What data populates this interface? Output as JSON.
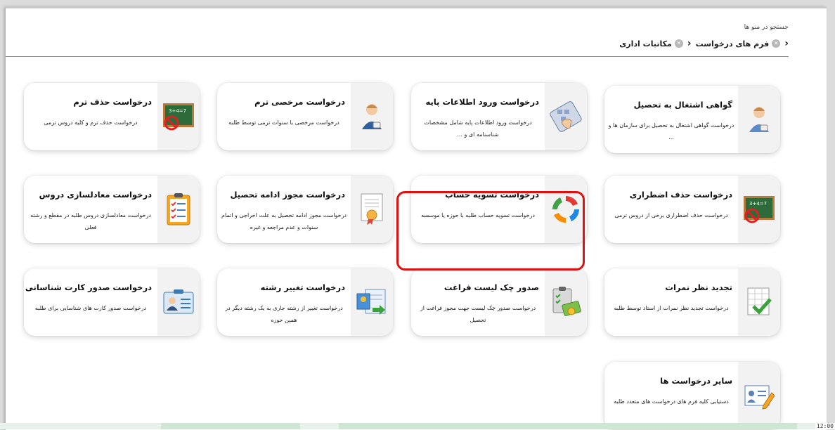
{
  "search": {
    "label": "جستجو در منو ها"
  },
  "breadcrumb": {
    "items": [
      {
        "label": "مکاتبات اداری"
      },
      {
        "label": "فرم های درخواست"
      }
    ]
  },
  "cards": [
    {
      "title": "گواهی اشتغال به تحصیل",
      "desc": "درخواست گواهی اشتغال به تحصیل برای سازمان ها و ...",
      "icon": "man-with-coffee-icon"
    },
    {
      "title": "درخواست ورود اطلاعات پایه",
      "desc": "درخواست ورود اطلاعات پایه شامل مشخصات شناسنامه ای و ...",
      "icon": "hand-on-keyboard-icon"
    },
    {
      "title": "درخواست مرخصی ترم",
      "desc": "درخواست مرخصی با سنوات ترمی توسط طلبه",
      "icon": "man-with-coffee-icon"
    },
    {
      "title": "درخواست حذف ترم",
      "desc": "درخواست حذف ترم و کلیه دروس ترمی",
      "icon": "chalkboard-prohibited-icon"
    },
    {
      "title": "درخواست حذف اضطراری",
      "desc": "درخواست حذف اضطراری برخی از دروس ترمی",
      "icon": "chalkboard-prohibited-icon"
    },
    {
      "title": "درخواست تسویه حساب",
      "desc": "درخواست تسویه حساب طلبه با حوزه یا موسسه",
      "icon": "circular-arrows-icon"
    },
    {
      "title": "درخواست مجوز ادامه تحصیل",
      "desc": "درخواست مجوز ادامه تحصیل به علت اخراجی و اتمام سنوات و عدم مراجعه و غیره",
      "icon": "certificate-icon"
    },
    {
      "title": "درخواست معادلسازی دروس",
      "desc": "درخواست معادلسازی دروس طلبه در مقطع و رشته فعلی",
      "icon": "checklist-clipboard-icon"
    },
    {
      "title": "تجدید نظر نمرات",
      "desc": "درخواست تجدید نظر نمرات از استاد توسط طلبه",
      "icon": "spreadsheet-check-icon"
    },
    {
      "title": "صدور چک لیست فراغت",
      "desc": "درخواست صدور چک لیست جهت مجوز فراغت از تحصیل",
      "icon": "clipboard-money-icon"
    },
    {
      "title": "درخواست تغییر رشته",
      "desc": "درخواست تغییر از رشته جاری به یک رشته دیگر در همین حوزه",
      "icon": "transfer-document-icon"
    },
    {
      "title": "درخواست صدور کارت شناسانی",
      "desc": "درخواست صدور کارت های شناسایی برای طلبه",
      "icon": "id-card-icon"
    },
    {
      "title": "سایر درخواست ها",
      "desc": "دستیابی کلیه فرم های درخواست های متعدد طلبه",
      "icon": "document-edit-icon"
    }
  ],
  "taskbar": {
    "clock": "12:00"
  }
}
